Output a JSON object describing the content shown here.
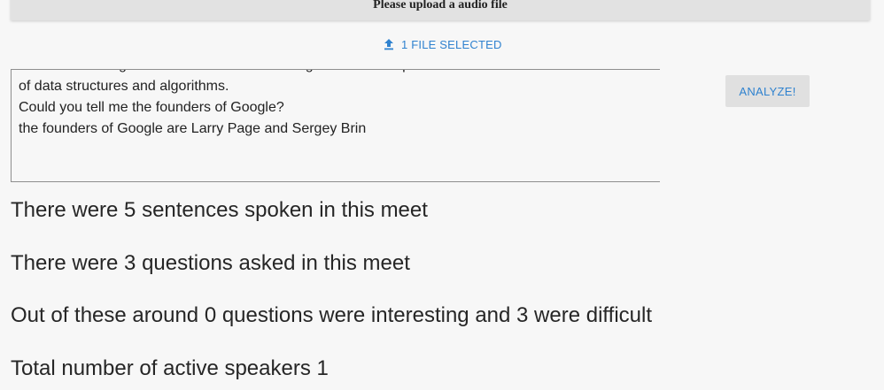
{
  "header": {
    "title": "Please upload a audio file"
  },
  "upload": {
    "icon": "upload-icon",
    "label": "1 FILE SELECTED"
  },
  "transcript": {
    "text": "Machine learning is a branch of Artificial Intelligence and computer science which focuses on the use\nof data structures and algorithms.\nCould you tell me the founders of Google?\nthe founders of Google are Larry Page and Sergey Brin"
  },
  "actions": {
    "analyze_label": "ANALYZE!"
  },
  "stats": {
    "sentences": "There were 5 sentences spoken in this meet",
    "questions": "There were 3 questions asked in this meet",
    "interesting": "Out of these around 0 questions were interesting and 3 were difficult",
    "speakers": "Total number of active speakers 1"
  },
  "colors": {
    "accent": "#2f82cf",
    "button_bg": "#e0e0e0",
    "page_bg": "#f7f7f7"
  }
}
